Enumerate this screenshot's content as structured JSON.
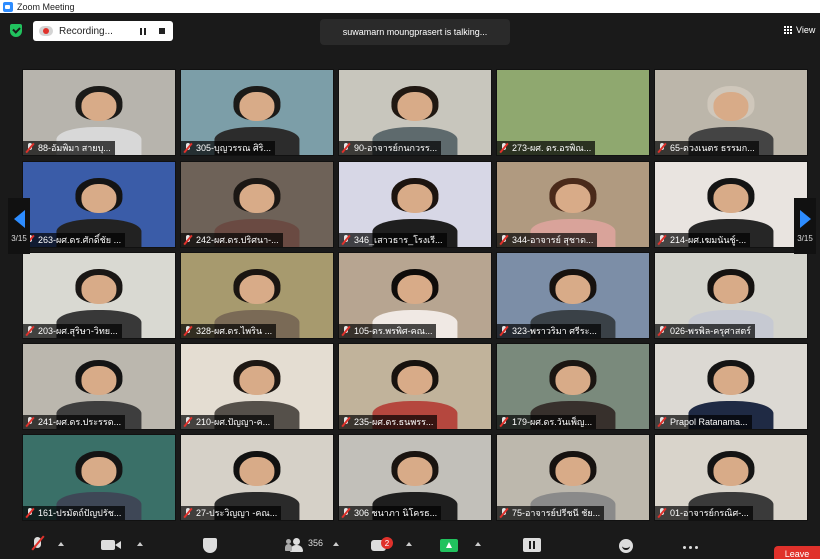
{
  "window": {
    "title": "Zoom Meeting"
  },
  "recording": {
    "label": "Recording..."
  },
  "speaker_banner": "suwamarn moungprasert is talking...",
  "view_label": "View",
  "page_indicator": {
    "left": "3/15",
    "right": "3/15"
  },
  "participants": [
    {
      "name": "88-อัมพิมา  สายบุ...",
      "bg": "#b7b4ad",
      "hair": "#1b1a18",
      "torso": "#d8d8d8"
    },
    {
      "name": "305-บุญวรรณ ศิริ...",
      "bg": "#7c9ea8",
      "hair": "#1b1a18",
      "torso": "#2c2c2c"
    },
    {
      "name": "90-อาจารย์กนกวรร...",
      "bg": "#c8c6bd",
      "hair": "#201812",
      "torso": "#5e6a6d"
    },
    {
      "name": "273-ผศ. ดร.อรพิณ...",
      "bg": "#8fa86f",
      "hair": "none",
      "torso": "none"
    },
    {
      "name": "65-ดวงเนตร ธรรมก...",
      "bg": "#bcb6aa",
      "hair": "#cfc7bb",
      "torso": "#444444"
    },
    {
      "name": "263-ผศ.ดร.ศักดิ์ชัย ...",
      "bg": "#3a5ca8",
      "hair": "#141414",
      "torso": "#222222"
    },
    {
      "name": "242-ผศ.ดร.ปริศนา-...",
      "bg": "#6e6258",
      "hair": "#1b1714",
      "torso": "#6a4a42"
    },
    {
      "name": "346_เสาวธาร_โรงเรี...",
      "bg": "#d7d7e6",
      "hair": "#1c1410",
      "torso": "#1e1e1e"
    },
    {
      "name": "344-อาจารย์ สุชาด...",
      "bg": "#b09a80",
      "hair": "#4a2a1a",
      "torso": "#d9a39a"
    },
    {
      "name": "214-ผศ.เฆมนันชู์-...",
      "bg": "#e9e4e0",
      "hair": "#141414",
      "torso": "#262626"
    },
    {
      "name": "203-ผศ.สุริษา-วิทย...",
      "bg": "#d9d9d2",
      "hair": "#1a1715",
      "torso": "#383838"
    },
    {
      "name": "328-ผศ.ดร.ไพริน ...",
      "bg": "#a79a6e",
      "hair": "#1a1511",
      "torso": "#7a6a56"
    },
    {
      "name": "105-ดร.พรพิศ-คณ...",
      "bg": "#b7a591",
      "hair": "#0f0c0a",
      "torso": "#f0e9e4"
    },
    {
      "name": "323-พราวริมา ศรีระ...",
      "bg": "#7c8ea7",
      "hair": "#17120f",
      "torso": "#3a4147"
    },
    {
      "name": "026-พรพิล-ครุศาสตร์",
      "bg": "#d3d3cc",
      "hair": "#151210",
      "torso": "#c6c9d2"
    },
    {
      "name": "241-ผศ.ดร.ประรรด...",
      "bg": "#bbb7ae",
      "hair": "#141414",
      "torso": "#3e3e3e"
    },
    {
      "name": "210-ผศ.ปัญญา-ค...",
      "bg": "#e4ddd2",
      "hair": "#1d1713",
      "torso": "#55504a"
    },
    {
      "name": "235-ผศ.ดร.ธนพรร...",
      "bg": "#c1b39b",
      "hair": "#17120e",
      "torso": "#b5473e"
    },
    {
      "name": "179-ผศ.ดร.วันเพ็ญ...",
      "bg": "#7a8a7c",
      "hair": "#1b1612",
      "torso": "#37302c"
    },
    {
      "name": "Prapol Ratanama...",
      "bg": "#dcd9d3",
      "hair": "#141414",
      "torso": "#1f2a44"
    },
    {
      "name": "161-ปรมัตถ์ปัญปรัช...",
      "bg": "#3a7068",
      "hair": "#141414",
      "torso": "#3e4756"
    },
    {
      "name": "27-ประวิญญา -คณ...",
      "bg": "#d6d1c8",
      "hair": "#111111",
      "torso": "#2a2a2a"
    },
    {
      "name": "306 ชนาภา นิโครธ...",
      "bg": "#c2c0ba",
      "hair": "#1a1410",
      "torso": "#1e1e1e"
    },
    {
      "name": "75-อาจารย์ปรีชนี ชัย...",
      "bg": "#bdb8ad",
      "hair": "#161210",
      "torso": "#8a8a8a"
    },
    {
      "name": "01-อาจารย์กรณิศ-...",
      "bg": "#d9d4cb",
      "hair": "#141414",
      "torso": "#3a3a3a"
    }
  ],
  "toolbar": {
    "participants_count": "356",
    "chat_badge": "2",
    "leave_label": "Leave"
  }
}
